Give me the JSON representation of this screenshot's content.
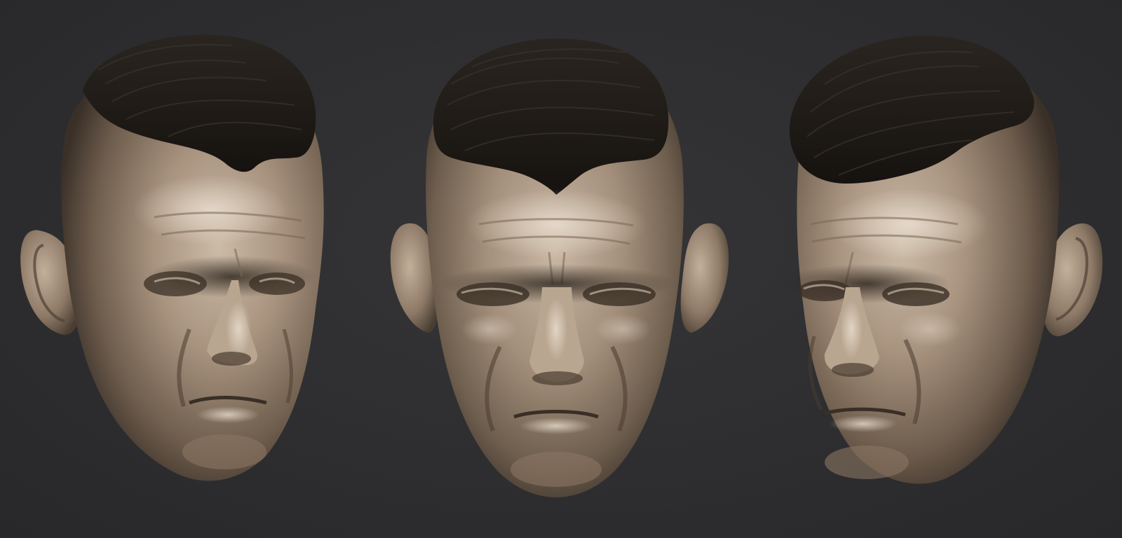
{
  "scene": {
    "background_color": "#2f2f31",
    "clay_color": "#a89480",
    "hair_color": "#1e1a16",
    "views": [
      {
        "id": "three-quarter-left",
        "kind": "head-sculpt"
      },
      {
        "id": "front",
        "kind": "head-sculpt"
      },
      {
        "id": "three-quarter-right",
        "kind": "head-sculpt"
      }
    ]
  }
}
